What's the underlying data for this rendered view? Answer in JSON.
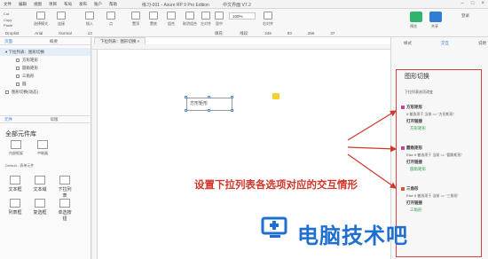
{
  "titlebar": {
    "menu": [
      "文件",
      "编辑",
      "视图",
      "项目",
      "布局",
      "发布",
      "账户",
      "帮助"
    ],
    "title": "练习-001 - Axure RP 9 Pro Edition",
    "title_suffix": "中文界面 V7.2"
  },
  "toolbar": {
    "clipboard": [
      "Cut",
      "Copy",
      "Paste"
    ],
    "items": [
      "选择模式",
      "连接",
      "插入",
      "点",
      "置顶",
      "置底",
      "组合",
      "取消组合",
      "左对齐",
      "居中",
      "右对齐"
    ],
    "zoom": "100%",
    "preview_label": "预览",
    "share_label": "共享",
    "login_label": "登录",
    "font_family": "Arial",
    "font_style": "Normal",
    "font_size": "13",
    "fill_label": "填充:",
    "border_label": "线段:",
    "x_value": "245",
    "y_value": "83",
    "w_value": "256",
    "h_value": "37",
    "droplist_label": "Droplist"
  },
  "left_panel": {
    "tabs": [
      "页面",
      "概要"
    ],
    "tree": {
      "page_title": "下拉列表：图形切换",
      "items": [
        "方形矩形",
        "圆角矩形",
        "三角形",
        "圆"
      ],
      "last_item": "图形切换(动态)"
    },
    "lib_tabs": [
      "元件",
      "母版"
    ],
    "lib_title": "全部元件库",
    "lib_items": [
      "内部框架",
      "中继器"
    ],
    "lib_select": "Default - 表单元件",
    "form_items": [
      "文本框",
      "文本域",
      "下拉列表",
      "列表框",
      "复选框",
      "单选按钮"
    ]
  },
  "canvas": {
    "tab_label": "下拉列表：图形切换",
    "widget_text": "方形矩形",
    "annotation": "设置下拉列表各选项对应的交互情形"
  },
  "right_panel": {
    "tabs": [
      "样式",
      "交互",
      "说明"
    ],
    "header": "图形切换",
    "event_label": "下拉列表选项改变",
    "events": [
      {
        "case": "方形矩形",
        "color": "#c8409a",
        "condition": "If 被选项于 当前 == \"方形矩形\"",
        "action_title": "打开链接",
        "action": "方形矩形"
      },
      {
        "case": "圆角矩形",
        "color": "#c8409a",
        "condition": "Else If 被选项于 当前 == \"圆角矩形\"",
        "action_title": "打开链接",
        "action": "圆角矩形"
      },
      {
        "case": "三角形",
        "color": "#d9533a",
        "condition": "Else If 被选项于 当前 == \"三角形\"",
        "action_title": "打开链接",
        "action": "三角形"
      }
    ]
  },
  "watermark": {
    "text": "电脑技术吧"
  },
  "colors": {
    "accent": "#2d7fd6",
    "annotation": "#d0362a",
    "highlight_box": "#d94040",
    "action": "#2a9a4a",
    "watermark": "#1f6fd0"
  }
}
